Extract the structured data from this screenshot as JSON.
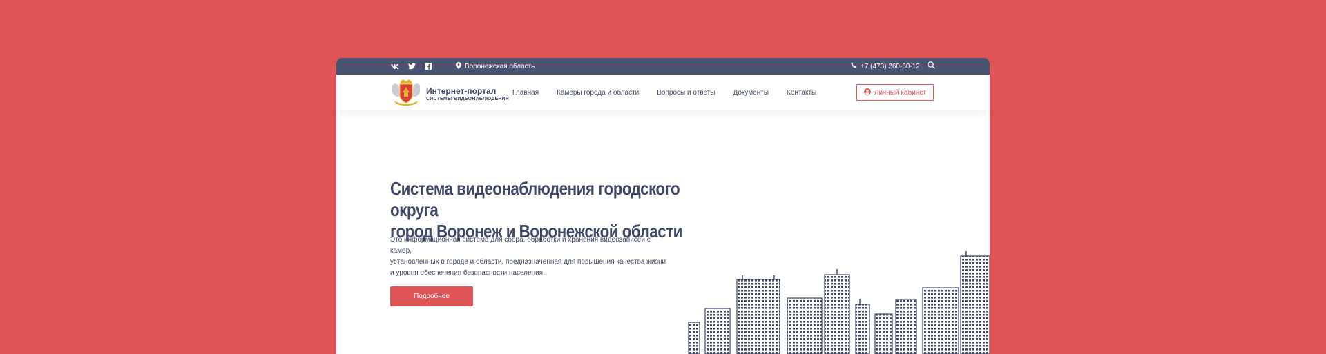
{
  "colors": {
    "background": "#DE5457",
    "topbar": "#4A5470",
    "accent": "#DE5457",
    "text": "#3F4966"
  },
  "topbar": {
    "social": [
      {
        "name": "vk-icon",
        "glyph": "vk"
      },
      {
        "name": "twitter-icon",
        "glyph": "twitter"
      },
      {
        "name": "facebook-icon",
        "glyph": "facebook"
      }
    ],
    "region": "Воронежская область",
    "phone": "+7 (473) 260-60-12",
    "search_icon": "search-icon"
  },
  "logo": {
    "title": "Интернет-портал",
    "subtitle": "СИСТЕМЫ ВИДЕОНАБЛЮДЕНИЯ",
    "icon": "coat-of-arms-icon"
  },
  "nav": {
    "items": [
      "Главная",
      "Камеры города и области",
      "Вопросы и ответы",
      "Документы",
      "Контакты"
    ]
  },
  "cabinet": {
    "label": "Личный кабинет",
    "icon": "user-circle-icon"
  },
  "hero": {
    "title_line1": "Система видеонаблюдения городского округа",
    "title_line2": "город Воронеж и Воронежской области",
    "text_line1": "Это информационная система для сбора, обработки и хранения видеозаписей с камер,",
    "text_line2": "установленных в городе и области, предназначенная для повышения качества жизни",
    "text_line3": "и уровня обеспечения безопасности населения.",
    "button": "Подробнее"
  }
}
